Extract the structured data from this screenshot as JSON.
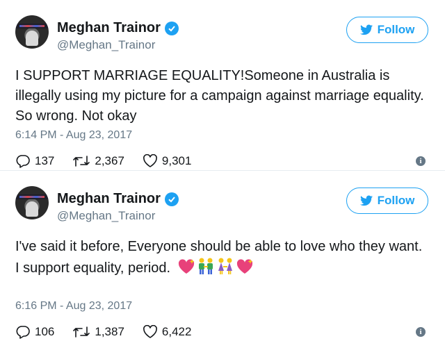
{
  "tweets": [
    {
      "author_name": "Meghan Trainor",
      "handle": "@Meghan_Trainor",
      "follow_label": "Follow",
      "text": "I SUPPORT MARRIAGE EQUALITY!Someone in Australia is illegally using my picture for a campaign against marriage equality. So wrong. Not okay",
      "timestamp": "6:14 PM - Aug 23, 2017",
      "replies": "137",
      "retweets": "2,367",
      "likes": "9,301"
    },
    {
      "author_name": "Meghan Trainor",
      "handle": "@Meghan_Trainor",
      "follow_label": "Follow",
      "text": "I've said it before, Everyone should be able to love who they want. I support equality, period.",
      "emojis": [
        "sparkling-heart-icon",
        "two-men-holding-hands-icon",
        "two-women-holding-hands-icon",
        "sparkling-heart-icon"
      ],
      "timestamp": "6:16 PM - Aug 23, 2017",
      "replies": "106",
      "retweets": "1,387",
      "likes": "6,422"
    }
  ],
  "colors": {
    "accent": "#1da1f2",
    "text": "#14171a",
    "muted": "#657786",
    "heart_emoji": "#e8417a"
  }
}
